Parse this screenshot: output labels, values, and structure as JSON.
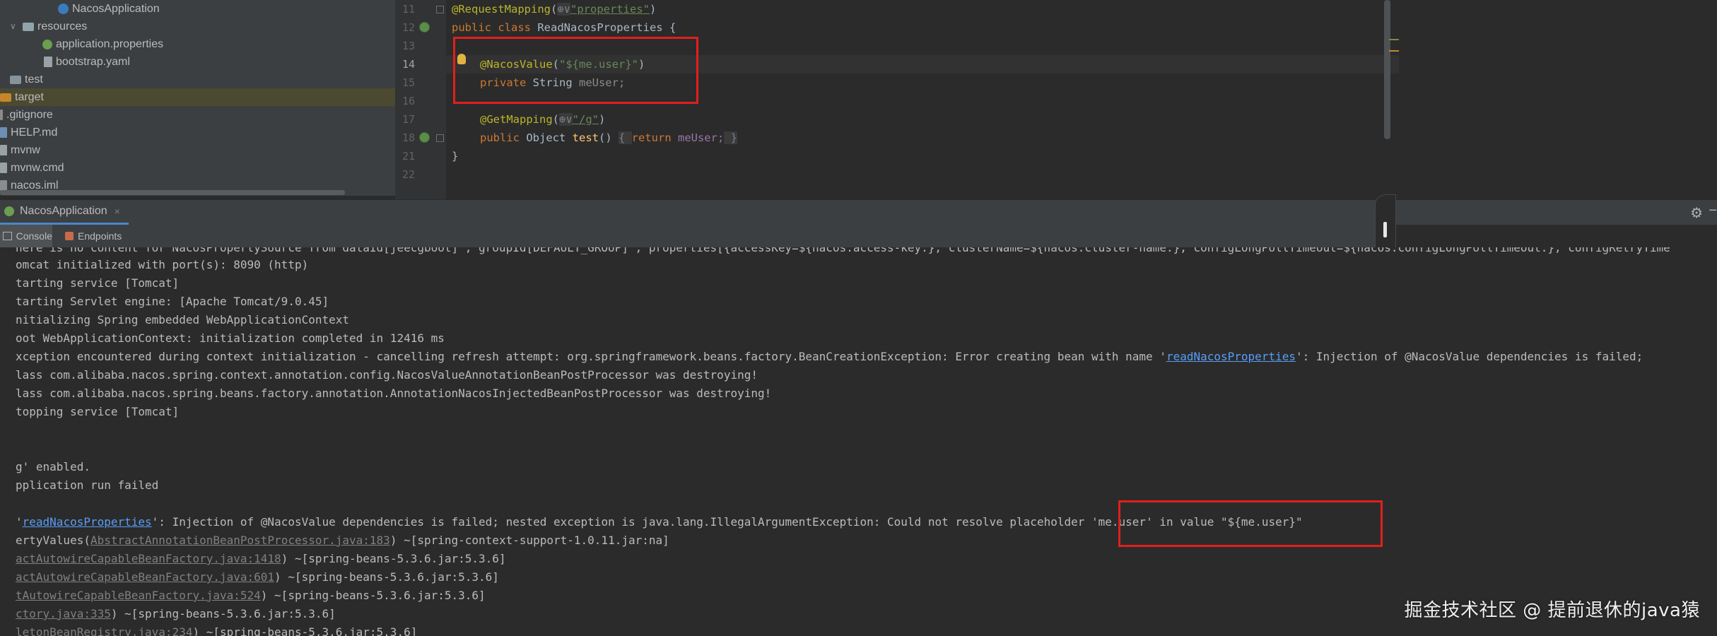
{
  "project_tree": {
    "items": [
      {
        "label": "NacosApplication",
        "icon": "spring-class-icon",
        "indent": 3,
        "expanded": null
      },
      {
        "label": "resources",
        "icon": "resources-folder-icon",
        "indent": 1,
        "expanded": true
      },
      {
        "label": "application.properties",
        "icon": "properties-file-icon",
        "indent": 2,
        "expanded": null
      },
      {
        "label": "bootstrap.yaml",
        "icon": "yaml-file-icon",
        "indent": 2,
        "expanded": null
      },
      {
        "label": "test",
        "icon": "folder-icon",
        "indent": 0,
        "expanded": false
      },
      {
        "label": "target",
        "icon": "target-folder-icon",
        "indent": 0,
        "expanded": false
      },
      {
        "label": ".gitignore",
        "icon": "gitignore-file-icon",
        "indent": 0,
        "expanded": null
      },
      {
        "label": "HELP.md",
        "icon": "markdown-file-icon",
        "indent": 0,
        "expanded": null
      },
      {
        "label": "mvnw",
        "icon": "file-icon",
        "indent": 0,
        "expanded": null
      },
      {
        "label": "mvnw.cmd",
        "icon": "file-icon",
        "indent": 0,
        "expanded": null
      },
      {
        "label": "nacos.iml",
        "icon": "iml-file-icon",
        "indent": 0,
        "expanded": null
      }
    ]
  },
  "editor": {
    "line_numbers": [
      "11",
      "12",
      "13",
      "14",
      "15",
      "16",
      "17",
      "18",
      "21",
      "22"
    ],
    "current_line": "14",
    "lines": {
      "l11": {
        "ann": "@RequestMapping",
        "p1": "(",
        "glyph": "⊕∨",
        "str": "\"properties\"",
        "p2": ")"
      },
      "l12": {
        "kw": "public class ",
        "name": "ReadNacosProperties {"
      },
      "l14": {
        "ann": "@NacosValue",
        "p1": "(",
        "str": "\"${me.user}\"",
        "p2": ")"
      },
      "l15": {
        "kw": "private ",
        "type": "String ",
        "field": "meUser;"
      },
      "l17": {
        "ann": "@GetMapping",
        "p1": "(",
        "glyph": "⊕∨",
        "str": "\"/g\"",
        "p2": ")"
      },
      "l18": {
        "kw": "public ",
        "type": "Object ",
        "method": "test",
        "p1": "() ",
        "f1": "{ ",
        "kw2": "return ",
        "field": "meUser;",
        "f2": " }"
      },
      "l21": {
        "text": "}"
      }
    }
  },
  "run_window": {
    "tab_label": "NacosApplication",
    "close_glyph": "×",
    "gear_glyph": "⚙",
    "minimize_glyph": "−",
    "subtabs": {
      "console": "Console",
      "endpoints": "Endpoints"
    }
  },
  "console": {
    "lines": [
      {
        "text": "here is no content for NacosPropertySource from dataId[jeecgboot] , groupId[DEFAULT_GROUP] , properties[{accessKey=${nacos.access-key:}, clusterName=${nacos.cluster-name:}, configLongPollTimeout=${nacos.configLongPollTimeout:}, configRetryTime"
      },
      {
        "text": "omcat initialized with port(s): 8090 (http)"
      },
      {
        "text": "tarting service [Tomcat]"
      },
      {
        "text": "tarting Servlet engine: [Apache Tomcat/9.0.45]"
      },
      {
        "text": "nitializing Spring embedded WebApplicationContext"
      },
      {
        "text": "oot WebApplicationContext: initialization completed in 12416 ms"
      },
      {
        "pre": "xception encountered during context initialization - cancelling refresh attempt: org.springframework.beans.factory.BeanCreationException: Error creating bean with name '",
        "link": "readNacosProperties",
        "post": "': Injection of @NacosValue dependencies is failed;"
      },
      {
        "text": "lass com.alibaba.nacos.spring.context.annotation.config.NacosValueAnnotationBeanPostProcessor was destroying!"
      },
      {
        "text": "lass com.alibaba.nacos.spring.beans.factory.annotation.AnnotationNacosInjectedBeanPostProcessor was destroying!"
      },
      {
        "text": "topping service [Tomcat]"
      },
      {
        "text": ""
      },
      {
        "text": ""
      },
      {
        "text": "g' enabled."
      },
      {
        "text": "pplication run failed"
      },
      {
        "text": ""
      },
      {
        "pre": "'",
        "link": "readNacosProperties",
        "post": "': Injection of @NacosValue dependencies is failed; nested exception is java.lang.IllegalArgumentException: Could not resolve placeholder 'me.user' in value \"${me.user}\""
      },
      {
        "pre": "ertyValues(",
        "stack": "AbstractAnnotationBeanPostProcessor.java:183",
        "post": ") ~[spring-context-support-1.0.11.jar:na]"
      },
      {
        "pre": "",
        "stack": "actAutowireCapableBeanFactory.java:1418",
        "post": ") ~[spring-beans-5.3.6.jar:5.3.6]"
      },
      {
        "pre": "",
        "stack": "actAutowireCapableBeanFactory.java:601",
        "post": ") ~[spring-beans-5.3.6.jar:5.3.6]"
      },
      {
        "pre": "",
        "stack": "tAutowireCapableBeanFactory.java:524",
        "post": ") ~[spring-beans-5.3.6.jar:5.3.6]"
      },
      {
        "pre": "",
        "stack": "ctory.java:335",
        "post": ") ~[spring-beans-5.3.6.jar:5.3.6]"
      },
      {
        "pre": "",
        "stack": "letonBeanRegistry.java:234",
        "post": ") ~[spring-beans-5.3.6.jar:5.3.6]"
      }
    ]
  },
  "watermark": "掘金技术社区 @ 提前退休的java猿",
  "colors": {
    "highlight_box": "#e0201b",
    "keyword": "#cc7832",
    "annotation": "#bbb529",
    "string": "#6a8759",
    "field": "#9876aa",
    "link": "#589df6"
  }
}
